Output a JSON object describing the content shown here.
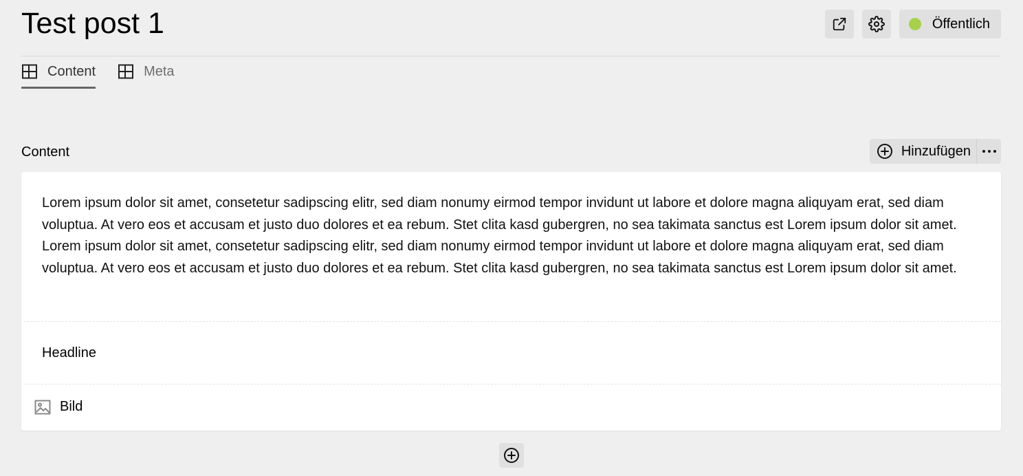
{
  "header": {
    "title": "Test post 1",
    "status_label": "Öffentlich",
    "status_color": "#a7d14a"
  },
  "tabs": [
    {
      "label": "Content",
      "icon": "table-layout-icon",
      "active": true
    },
    {
      "label": "Meta",
      "icon": "table-layout-icon",
      "active": false
    }
  ],
  "section": {
    "label": "Content",
    "add_label": "Hinzufügen",
    "more_label": "⋯"
  },
  "blocks": {
    "text": "Lorem ipsum dolor sit amet, consetetur sadipscing elitr, sed diam nonumy eirmod tempor invidunt ut labore et dolore magna aliquyam erat, sed diam voluptua. At vero eos et accusam et justo duo dolores et ea rebum. Stet clita kasd gubergren, no sea takimata sanctus est Lorem ipsum dolor sit amet. Lorem ipsum dolor sit amet, consetetur sadipscing elitr, sed diam nonumy eirmod tempor invidunt ut labore et dolore magna aliquyam erat, sed diam voluptua. At vero eos et accusam et justo duo dolores et ea rebum. Stet clita kasd gubergren, no sea takimata sanctus est Lorem ipsum dolor sit amet.",
    "headline": "Headline",
    "image_label": "Bild"
  },
  "icons": {
    "open": "external-link-icon",
    "settings": "gear-icon",
    "add": "plus-circle-icon",
    "image": "image-icon"
  }
}
